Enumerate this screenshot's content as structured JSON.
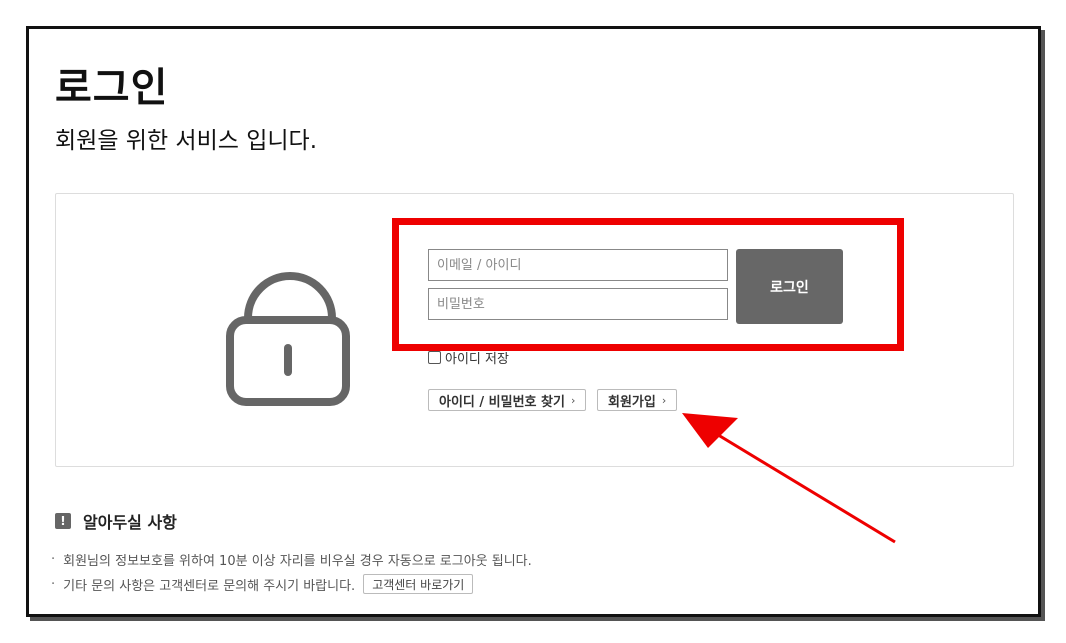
{
  "page": {
    "title": "로그인",
    "subtitle": "회원을 위한 서비스 입니다."
  },
  "login_form": {
    "email_placeholder": "이메일 / 아이디",
    "password_placeholder": "비밀번호",
    "login_button": "로그인",
    "remember_label": "아이디 저장",
    "find_button": "아이디 / 비밀번호 찾기",
    "signup_button": "회원가입",
    "chevron": "›"
  },
  "notice": {
    "heading": "알아두실 사항",
    "lines": [
      "회원님의 정보보호를 위하여 10분 이상 자리를 비우실 경우 자동으로 로그아웃 됩니다.",
      "기타 문의 사항은 고객센터로 문의해 주시기 바랍니다."
    ],
    "bullet": "·",
    "cs_button": "고객센터 바로가기"
  },
  "icons": {
    "lock": "lock-icon",
    "notice": "exclamation-icon"
  },
  "colors": {
    "highlight": "#ee0000",
    "login_button": "#676767",
    "arrow": "#ee0000"
  }
}
